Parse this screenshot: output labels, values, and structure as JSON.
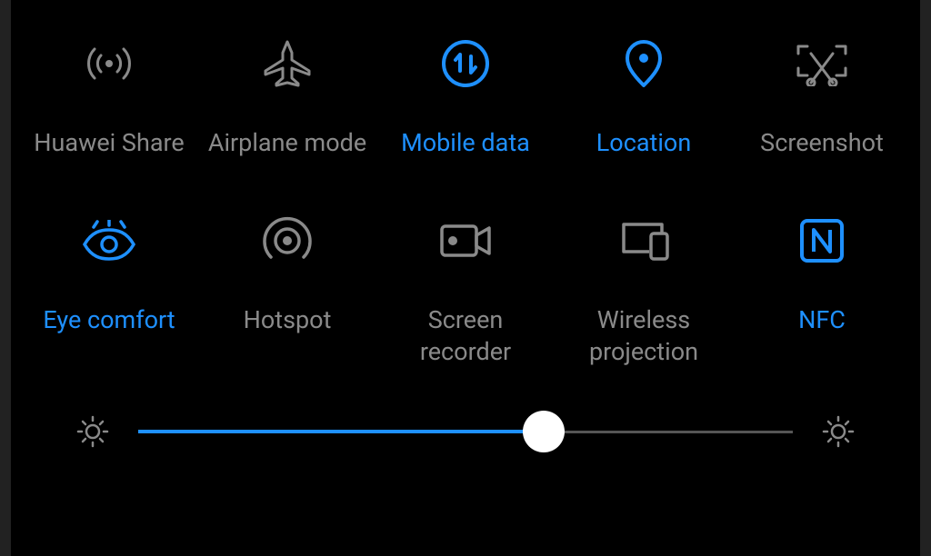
{
  "accent": "#1e90ff",
  "inactive_color": "#8a8a8a",
  "tiles": [
    {
      "id": "huawei-share",
      "label": "Huawei Share",
      "active": false,
      "icon": "broadcast-icon"
    },
    {
      "id": "airplane-mode",
      "label": "Airplane mode",
      "active": false,
      "icon": "airplane-icon"
    },
    {
      "id": "mobile-data",
      "label": "Mobile data",
      "active": true,
      "icon": "mobile-data-icon"
    },
    {
      "id": "location",
      "label": "Location",
      "active": true,
      "icon": "location-pin-icon"
    },
    {
      "id": "screenshot",
      "label": "Screenshot",
      "active": false,
      "icon": "screenshot-icon"
    },
    {
      "id": "eye-comfort",
      "label": "Eye comfort",
      "active": true,
      "icon": "eye-icon"
    },
    {
      "id": "hotspot",
      "label": "Hotspot",
      "active": false,
      "icon": "hotspot-icon"
    },
    {
      "id": "screen-recorder",
      "label": "Screen\nrecorder",
      "active": false,
      "icon": "screen-recorder-icon"
    },
    {
      "id": "wireless-projection",
      "label": "Wireless\nprojection",
      "active": false,
      "icon": "wireless-projection-icon"
    },
    {
      "id": "nfc",
      "label": "NFC",
      "active": true,
      "icon": "nfc-icon"
    }
  ],
  "brightness": {
    "percent": 62
  }
}
